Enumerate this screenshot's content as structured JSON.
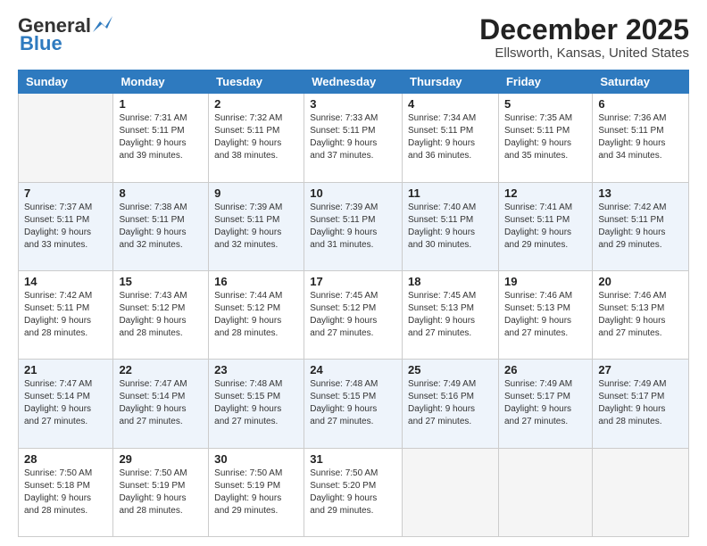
{
  "logo": {
    "line1": "General",
    "line2": "Blue"
  },
  "title": "December 2025",
  "subtitle": "Ellsworth, Kansas, United States",
  "days_header": [
    "Sunday",
    "Monday",
    "Tuesday",
    "Wednesday",
    "Thursday",
    "Friday",
    "Saturday"
  ],
  "weeks": [
    [
      {
        "day": "",
        "info": ""
      },
      {
        "day": "1",
        "info": "Sunrise: 7:31 AM\nSunset: 5:11 PM\nDaylight: 9 hours\nand 39 minutes."
      },
      {
        "day": "2",
        "info": "Sunrise: 7:32 AM\nSunset: 5:11 PM\nDaylight: 9 hours\nand 38 minutes."
      },
      {
        "day": "3",
        "info": "Sunrise: 7:33 AM\nSunset: 5:11 PM\nDaylight: 9 hours\nand 37 minutes."
      },
      {
        "day": "4",
        "info": "Sunrise: 7:34 AM\nSunset: 5:11 PM\nDaylight: 9 hours\nand 36 minutes."
      },
      {
        "day": "5",
        "info": "Sunrise: 7:35 AM\nSunset: 5:11 PM\nDaylight: 9 hours\nand 35 minutes."
      },
      {
        "day": "6",
        "info": "Sunrise: 7:36 AM\nSunset: 5:11 PM\nDaylight: 9 hours\nand 34 minutes."
      }
    ],
    [
      {
        "day": "7",
        "info": "Sunrise: 7:37 AM\nSunset: 5:11 PM\nDaylight: 9 hours\nand 33 minutes."
      },
      {
        "day": "8",
        "info": "Sunrise: 7:38 AM\nSunset: 5:11 PM\nDaylight: 9 hours\nand 32 minutes."
      },
      {
        "day": "9",
        "info": "Sunrise: 7:39 AM\nSunset: 5:11 PM\nDaylight: 9 hours\nand 32 minutes."
      },
      {
        "day": "10",
        "info": "Sunrise: 7:39 AM\nSunset: 5:11 PM\nDaylight: 9 hours\nand 31 minutes."
      },
      {
        "day": "11",
        "info": "Sunrise: 7:40 AM\nSunset: 5:11 PM\nDaylight: 9 hours\nand 30 minutes."
      },
      {
        "day": "12",
        "info": "Sunrise: 7:41 AM\nSunset: 5:11 PM\nDaylight: 9 hours\nand 29 minutes."
      },
      {
        "day": "13",
        "info": "Sunrise: 7:42 AM\nSunset: 5:11 PM\nDaylight: 9 hours\nand 29 minutes."
      }
    ],
    [
      {
        "day": "14",
        "info": "Sunrise: 7:42 AM\nSunset: 5:11 PM\nDaylight: 9 hours\nand 28 minutes."
      },
      {
        "day": "15",
        "info": "Sunrise: 7:43 AM\nSunset: 5:12 PM\nDaylight: 9 hours\nand 28 minutes."
      },
      {
        "day": "16",
        "info": "Sunrise: 7:44 AM\nSunset: 5:12 PM\nDaylight: 9 hours\nand 28 minutes."
      },
      {
        "day": "17",
        "info": "Sunrise: 7:45 AM\nSunset: 5:12 PM\nDaylight: 9 hours\nand 27 minutes."
      },
      {
        "day": "18",
        "info": "Sunrise: 7:45 AM\nSunset: 5:13 PM\nDaylight: 9 hours\nand 27 minutes."
      },
      {
        "day": "19",
        "info": "Sunrise: 7:46 AM\nSunset: 5:13 PM\nDaylight: 9 hours\nand 27 minutes."
      },
      {
        "day": "20",
        "info": "Sunrise: 7:46 AM\nSunset: 5:13 PM\nDaylight: 9 hours\nand 27 minutes."
      }
    ],
    [
      {
        "day": "21",
        "info": "Sunrise: 7:47 AM\nSunset: 5:14 PM\nDaylight: 9 hours\nand 27 minutes."
      },
      {
        "day": "22",
        "info": "Sunrise: 7:47 AM\nSunset: 5:14 PM\nDaylight: 9 hours\nand 27 minutes."
      },
      {
        "day": "23",
        "info": "Sunrise: 7:48 AM\nSunset: 5:15 PM\nDaylight: 9 hours\nand 27 minutes."
      },
      {
        "day": "24",
        "info": "Sunrise: 7:48 AM\nSunset: 5:15 PM\nDaylight: 9 hours\nand 27 minutes."
      },
      {
        "day": "25",
        "info": "Sunrise: 7:49 AM\nSunset: 5:16 PM\nDaylight: 9 hours\nand 27 minutes."
      },
      {
        "day": "26",
        "info": "Sunrise: 7:49 AM\nSunset: 5:17 PM\nDaylight: 9 hours\nand 27 minutes."
      },
      {
        "day": "27",
        "info": "Sunrise: 7:49 AM\nSunset: 5:17 PM\nDaylight: 9 hours\nand 28 minutes."
      }
    ],
    [
      {
        "day": "28",
        "info": "Sunrise: 7:50 AM\nSunset: 5:18 PM\nDaylight: 9 hours\nand 28 minutes."
      },
      {
        "day": "29",
        "info": "Sunrise: 7:50 AM\nSunset: 5:19 PM\nDaylight: 9 hours\nand 28 minutes."
      },
      {
        "day": "30",
        "info": "Sunrise: 7:50 AM\nSunset: 5:19 PM\nDaylight: 9 hours\nand 29 minutes."
      },
      {
        "day": "31",
        "info": "Sunrise: 7:50 AM\nSunset: 5:20 PM\nDaylight: 9 hours\nand 29 minutes."
      },
      {
        "day": "",
        "info": ""
      },
      {
        "day": "",
        "info": ""
      },
      {
        "day": "",
        "info": ""
      }
    ]
  ]
}
